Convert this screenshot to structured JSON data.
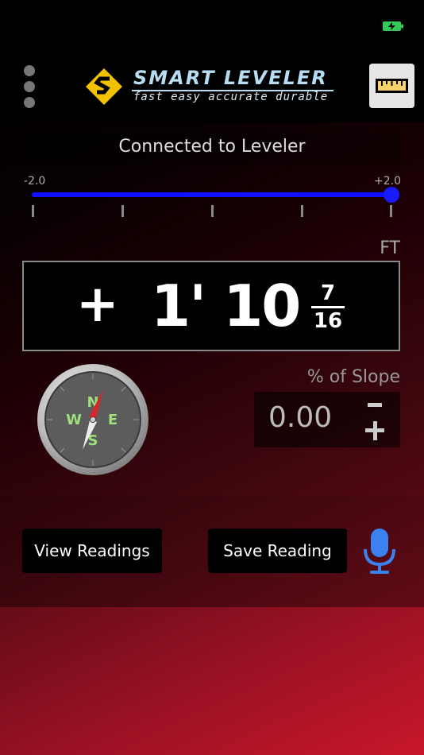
{
  "header": {
    "brand_name": "SMART LEVELER",
    "tagline": "fast   easy   accurate   durable",
    "icons": {
      "menu": "more-vertical-icon",
      "logo": "smart-leveler-logo-icon",
      "ruler": "ruler-icon",
      "battery": "battery-charging-icon"
    }
  },
  "status": {
    "connection": "Connected to Leveler"
  },
  "range": {
    "min_label": "-2.0",
    "max_label": "+2.0",
    "value": 2.0
  },
  "reading": {
    "unit": "FT",
    "sign": "+",
    "feet_inches": "1' 10",
    "fraction_numerator": "7",
    "fraction_denominator": "16"
  },
  "slope": {
    "label": "% of Slope",
    "value": "0.00"
  },
  "compass": {
    "north": "N",
    "east": "E",
    "south": "S",
    "west": "W"
  },
  "actions": {
    "view_readings": "View Readings",
    "save_reading": "Save Reading",
    "mic_icon": "microphone-icon"
  },
  "colors": {
    "accent_blue": "#1a1aff",
    "brand_yellow": "#f2c200",
    "mic_blue": "#3a82f0",
    "battery_green": "#35c759"
  }
}
